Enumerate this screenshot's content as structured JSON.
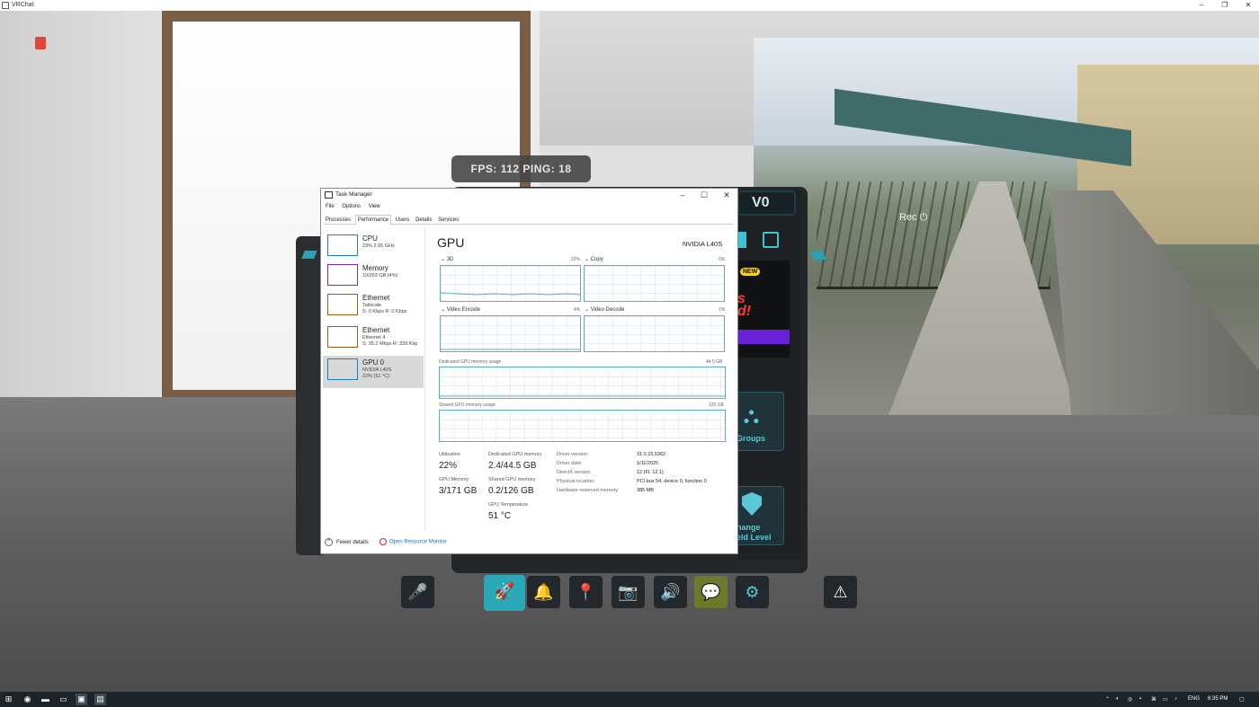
{
  "window": {
    "title": "VRChat",
    "controls": [
      "–",
      "❐",
      "✕"
    ]
  },
  "hud": {
    "fps_text": "FPS: 112  PING: 18",
    "badge": "V0",
    "rec_label": "Rec ⏻"
  },
  "ad": {
    "new_label": "NEW",
    "text": "s\nd!"
  },
  "side_buttons": {
    "groups": "Groups",
    "shield_line1": "hange",
    "shield_line2": "eld Level"
  },
  "dock": {
    "buttons": [
      {
        "name": "mic-muted-icon",
        "glyph": "🎤"
      },
      {
        "name": "rocket-icon",
        "glyph": "🚀"
      },
      {
        "name": "bell-icon",
        "glyph": "🔔"
      },
      {
        "name": "location-pin-icon",
        "glyph": "📍"
      },
      {
        "name": "camera-icon",
        "glyph": "📷"
      },
      {
        "name": "speaker-icon",
        "glyph": "🔊"
      },
      {
        "name": "chat-icon",
        "glyph": "💬"
      },
      {
        "name": "gear-icon",
        "glyph": "⚙"
      },
      {
        "name": "warning-icon",
        "glyph": "⚠"
      }
    ]
  },
  "taskmanager": {
    "title": "Task Manager",
    "menu": [
      "File",
      "Options",
      "View"
    ],
    "tabs": [
      "Processes",
      "Performance",
      "Users",
      "Details",
      "Services"
    ],
    "active_tab": "Performance",
    "sidebar": [
      {
        "name": "CPU",
        "sub1": "23% 2.65 GHz",
        "sub2": "",
        "color": "#1f7fc2"
      },
      {
        "name": "Memory",
        "sub1": "10/253 GB (4%)",
        "sub2": "",
        "color": "#8b2aa8"
      },
      {
        "name": "Ethernet",
        "sub1": "Tailscale",
        "sub2": "S: 0 Kbps  R: 0 Kbps",
        "color": "#a55a1c"
      },
      {
        "name": "Ethernet",
        "sub1": "Ethernet 4",
        "sub2": "S: 35.2 Mbps  R: 328 Kbp",
        "color": "#a55a1c"
      },
      {
        "name": "GPU 0",
        "sub1": "NVIDIA L40S",
        "sub2": "22% (51 °C)",
        "color": "#1f7fc2"
      }
    ],
    "gpu": {
      "title": "GPU",
      "model": "NVIDIA L40S",
      "engines": [
        {
          "label": "3D",
          "pct": "22%"
        },
        {
          "label": "Copy",
          "pct": "0%"
        },
        {
          "label": "Video Encode",
          "pct": "4%"
        },
        {
          "label": "Video Decode",
          "pct": "1%"
        }
      ],
      "dedicated_label": "Dedicated GPU memory usage",
      "dedicated_max": "44.5 GB",
      "shared_label": "Shared GPU memory usage",
      "shared_max": "126 GB",
      "stats": {
        "utilization_label": "Utilization",
        "utilization": "22%",
        "dedicated_label": "Dedicated GPU memory",
        "dedicated": "2.4/44.5 GB",
        "gpu_memory_label": "GPU Memory",
        "gpu_memory": "3/171 GB",
        "shared_label": "Shared GPU memory",
        "shared": "0.2/126 GB",
        "temp_label": "GPU Temperature",
        "temp": "51 °C"
      },
      "props": [
        {
          "label": "Driver version:",
          "value": "31.0.15.5362"
        },
        {
          "label": "Driver date:",
          "value": "1/11/2025"
        },
        {
          "label": "DirectX version:",
          "value": "12 (FL 12.1)"
        },
        {
          "label": "Physical location:",
          "value": "PCI bus 54, device 0, function 0"
        },
        {
          "label": "Hardware reserved memory:",
          "value": "385 MB"
        }
      ]
    },
    "footer": {
      "fewer": "Fewer details",
      "monitor": "Open Resource Monitor"
    }
  },
  "taskbar": {
    "lang": "ENG",
    "time": "6:35 PM"
  }
}
